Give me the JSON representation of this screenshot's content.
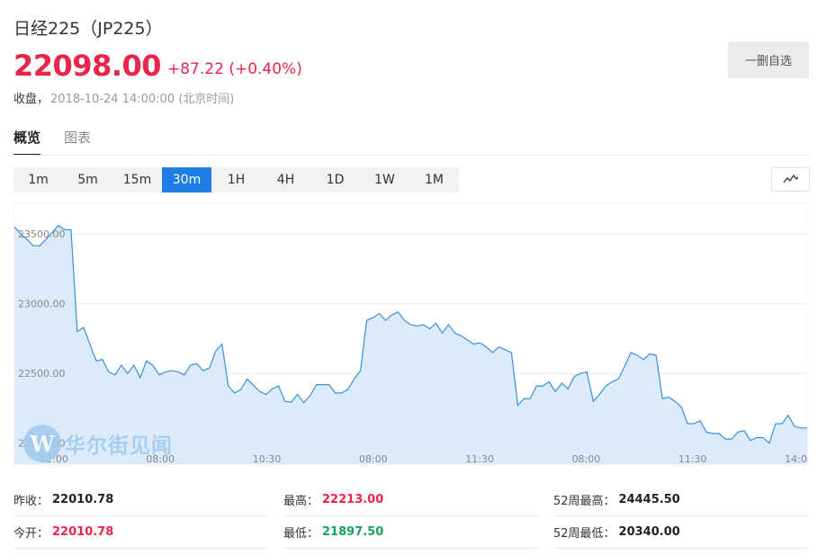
{
  "header": {
    "title": "日经225（JP225）",
    "price": "22098.00",
    "change": "+87.22 (+0.40%)",
    "status": "收盘，",
    "timestamp": "2018-10-24 14:00:00 (北京时间)",
    "watch_button": "一删自选"
  },
  "tabs": [
    {
      "label": "概览",
      "active": true
    },
    {
      "label": "图表",
      "active": false
    }
  ],
  "periods": [
    {
      "label": "1m",
      "active": false
    },
    {
      "label": "5m",
      "active": false
    },
    {
      "label": "15m",
      "active": false
    },
    {
      "label": "30m",
      "active": true
    },
    {
      "label": "1H",
      "active": false
    },
    {
      "label": "4H",
      "active": false
    },
    {
      "label": "1D",
      "active": false
    },
    {
      "label": "1W",
      "active": false
    },
    {
      "label": "1M",
      "active": false
    }
  ],
  "chart_type_icon": "line-chart-icon",
  "watermark": {
    "logo_letter": "W",
    "text": "华尔街见闻"
  },
  "colors": {
    "up": "#e8254a",
    "down": "#1aa260",
    "accent": "#1e7ee5",
    "line": "#3a8fe0",
    "fill": "#dcebfa"
  },
  "chart_data": {
    "type": "area",
    "ylim": [
      21850,
      23700
    ],
    "yticks": [
      22000,
      22500,
      23000,
      23500
    ],
    "ytick_labels": [
      "22000.00",
      "22500.00",
      "23000.00",
      "23500.00"
    ],
    "xtick_labels": [
      "12:00",
      "08:00",
      "10:30",
      "08:00",
      "11:30",
      "08:00",
      "11:30",
      "14:00"
    ],
    "grid": true,
    "values": [
      23550,
      23500,
      23460,
      23415,
      23415,
      23460,
      23510,
      23560,
      23530,
      23530,
      22800,
      22830,
      22710,
      22590,
      22600,
      22510,
      22490,
      22560,
      22500,
      22560,
      22470,
      22590,
      22560,
      22490,
      22510,
      22520,
      22510,
      22490,
      22560,
      22570,
      22520,
      22540,
      22660,
      22710,
      22410,
      22360,
      22385,
      22460,
      22415,
      22370,
      22350,
      22390,
      22410,
      22300,
      22295,
      22350,
      22290,
      22340,
      22420,
      22420,
      22420,
      22360,
      22360,
      22385,
      22460,
      22520,
      22880,
      22900,
      22930,
      22880,
      22920,
      22940,
      22880,
      22850,
      22840,
      22850,
      22820,
      22860,
      22790,
      22850,
      22790,
      22770,
      22740,
      22710,
      22720,
      22690,
      22650,
      22690,
      22670,
      22650,
      22270,
      22320,
      22320,
      22410,
      22410,
      22440,
      22370,
      22430,
      22390,
      22480,
      22500,
      22510,
      22300,
      22350,
      22410,
      22440,
      22460,
      22550,
      22650,
      22630,
      22600,
      22640,
      22630,
      22320,
      22330,
      22300,
      22260,
      22140,
      22140,
      22160,
      22080,
      22070,
      22070,
      22030,
      22030,
      22080,
      22090,
      22020,
      22040,
      22040,
      22000,
      22140,
      22140,
      22200,
      22120,
      22110,
      22110
    ]
  },
  "stats": [
    {
      "label": "昨收：",
      "value": "22010.78",
      "color": "default"
    },
    {
      "label": "最高：",
      "value": "22213.00",
      "color": "red"
    },
    {
      "label": "52周最高：",
      "value": "24445.50",
      "color": "default"
    },
    {
      "label": "今开：",
      "value": "22010.78",
      "color": "red"
    },
    {
      "label": "最低：",
      "value": "21897.50",
      "color": "green"
    },
    {
      "label": "52周最低：",
      "value": "20340.00",
      "color": "default"
    }
  ]
}
